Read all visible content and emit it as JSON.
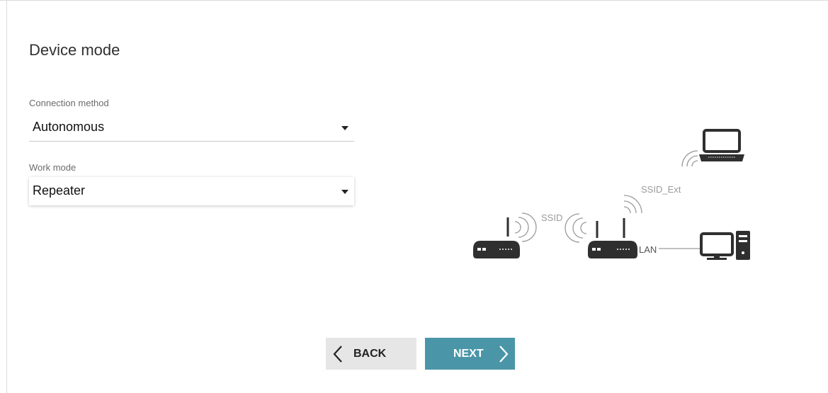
{
  "page": {
    "title": "Device mode"
  },
  "form": {
    "connection_method": {
      "label": "Connection method",
      "value": "Autonomous"
    },
    "work_mode": {
      "label": "Work mode",
      "value": "Repeater"
    }
  },
  "diagram": {
    "ssid_label": "SSID",
    "ssid_ext_label": "SSID_Ext",
    "lan_label": "LAN"
  },
  "buttons": {
    "back": "BACK",
    "next": "NEXT"
  },
  "colors": {
    "next_button": "#4a96a8",
    "back_button": "#e6e6e6",
    "diagram_dark": "#2f2f2f",
    "diagram_light": "#9a9a9a"
  }
}
